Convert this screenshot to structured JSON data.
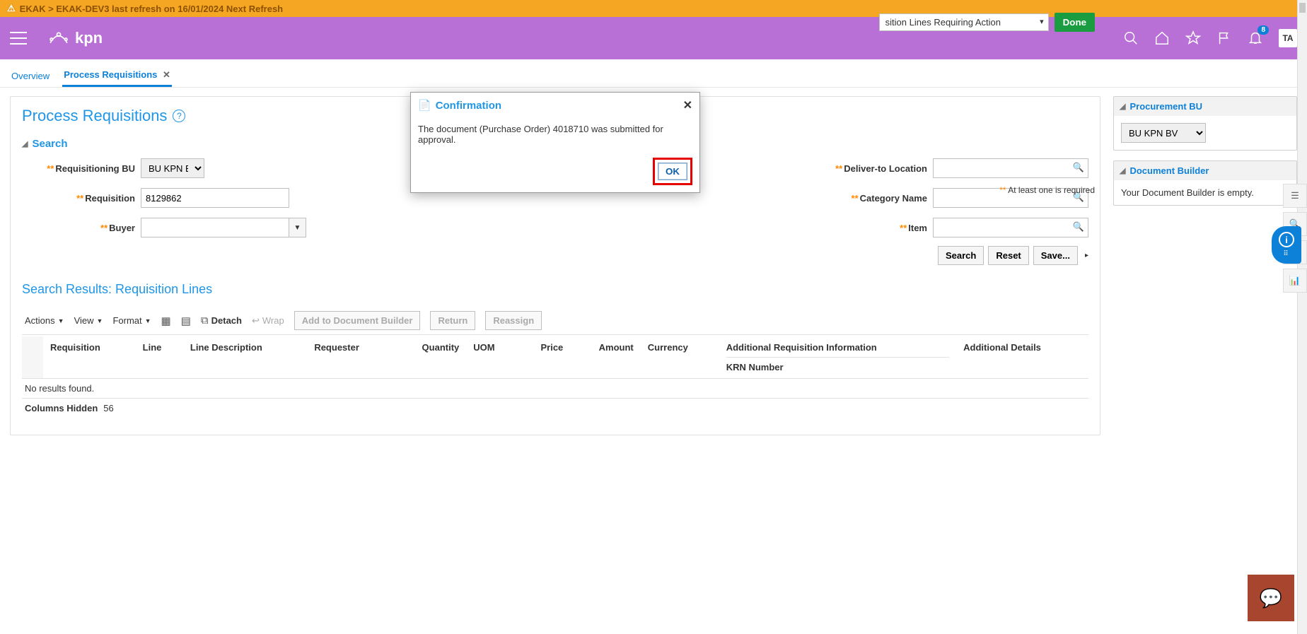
{
  "warnBar": "EKAK > EKAK-DEV3 last refresh on 16/01/2024 Next Refresh",
  "brand": "kpn",
  "notificationCount": "8",
  "avatarInitials": "TA",
  "tabs": {
    "overview": "Overview",
    "process": "Process Requisitions"
  },
  "page": {
    "title": "Process Requisitions",
    "doneLabel": "Done",
    "viewSelectValue": "sition Lines Requiring Action",
    "atLeast": "** At least one is required"
  },
  "search": {
    "header": "Search",
    "labels": {
      "reqBU": "Requisitioning BU",
      "requisition": "Requisition",
      "buyer": "Buyer",
      "deliverTo": "Deliver-to Location",
      "categoryName": "Category Name",
      "item": "Item"
    },
    "values": {
      "reqBU": "BU KPN BV",
      "requisition": "8129862",
      "buyer": "",
      "deliverTo": "",
      "categoryName": "",
      "item": ""
    },
    "buttons": {
      "search": "Search",
      "reset": "Reset",
      "save": "Save..."
    }
  },
  "results": {
    "title": "Search Results: Requisition Lines",
    "toolbar": {
      "actions": "Actions",
      "view": "View",
      "format": "Format",
      "detach": "Detach",
      "wrap": "Wrap",
      "addDoc": "Add to Document Builder",
      "return": "Return",
      "reassign": "Reassign"
    },
    "columns": {
      "requisition": "Requisition",
      "line": "Line",
      "lineDesc": "Line Description",
      "requester": "Requester",
      "quantity": "Quantity",
      "uom": "UOM",
      "price": "Price",
      "amount": "Amount",
      "currency": "Currency",
      "addlReqInfo": "Additional Requisition Information",
      "krn": "KRN Number",
      "addlDetails": "Additional Details"
    },
    "noResults": "No results found.",
    "colsHiddenLabel": "Columns Hidden",
    "colsHiddenCount": "56"
  },
  "side": {
    "procBU": {
      "header": "Procurement BU",
      "value": "BU KPN BV"
    },
    "docBuilder": {
      "header": "Document Builder",
      "empty": "Your Document Builder is empty."
    }
  },
  "modal": {
    "title": "Confirmation",
    "message": "The document (Purchase Order) 4018710 was submitted for approval.",
    "ok": "OK"
  }
}
